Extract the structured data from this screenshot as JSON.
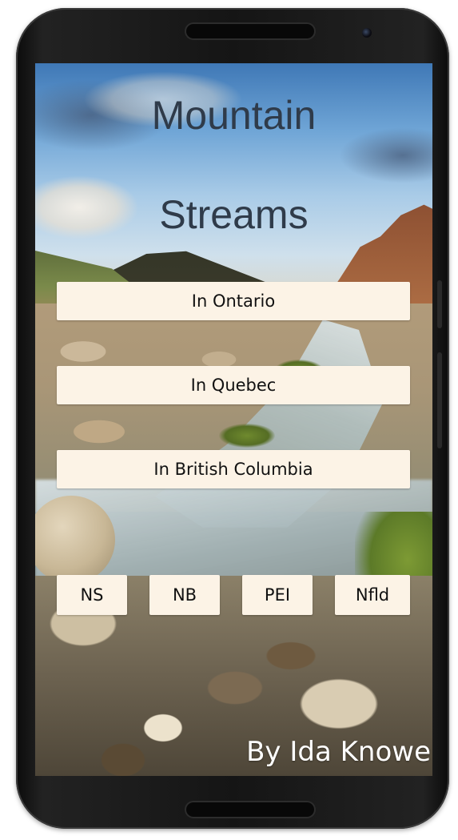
{
  "app": {
    "title_line1": "Mountain",
    "title_line2": "Streams",
    "byline": "By Ida Knowe"
  },
  "regions": [
    {
      "label": "In Ontario"
    },
    {
      "label": "In Quebec"
    },
    {
      "label": "In British Columbia"
    }
  ],
  "provinces": [
    {
      "label": "NS"
    },
    {
      "label": "NB"
    },
    {
      "label": "PEI"
    },
    {
      "label": "Nfld"
    }
  ],
  "colors": {
    "button_background": "#fcf3e6",
    "title_text": "#2f3b4a",
    "byline_text": "#ffffff"
  }
}
